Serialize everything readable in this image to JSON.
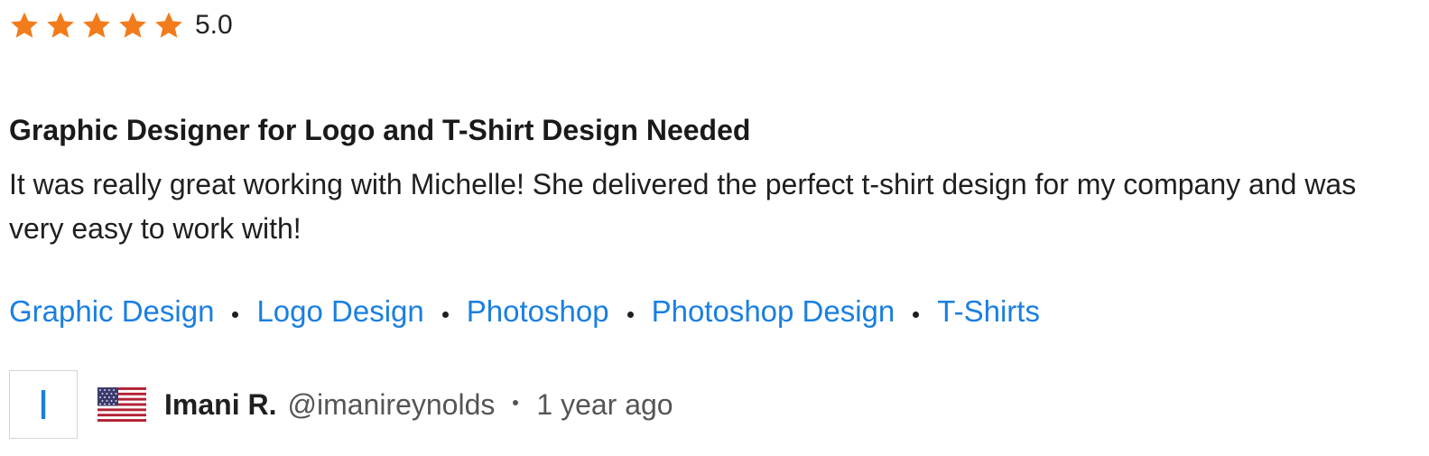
{
  "rating": {
    "stars_filled": 5,
    "stars_total": 5,
    "value_text": "5.0",
    "star_color": "#f27c1b"
  },
  "review": {
    "title": "Graphic Designer for Logo and T-Shirt Design Needed",
    "text": "It was really great working with Michelle! She delivered the perfect t-shirt design for my company and was very easy to work with!"
  },
  "tags": [
    {
      "label": "Graphic Design"
    },
    {
      "label": "Logo Design"
    },
    {
      "label": "Photoshop"
    },
    {
      "label": "Photoshop Design"
    },
    {
      "label": "T-Shirts"
    }
  ],
  "tag_color": "#1a7fe0",
  "reviewer": {
    "avatar_initial": "I",
    "country_flag_icon": "us-flag-icon",
    "name": "Imani R.",
    "handle": "@imanireynolds",
    "time_ago": "1 year ago"
  }
}
